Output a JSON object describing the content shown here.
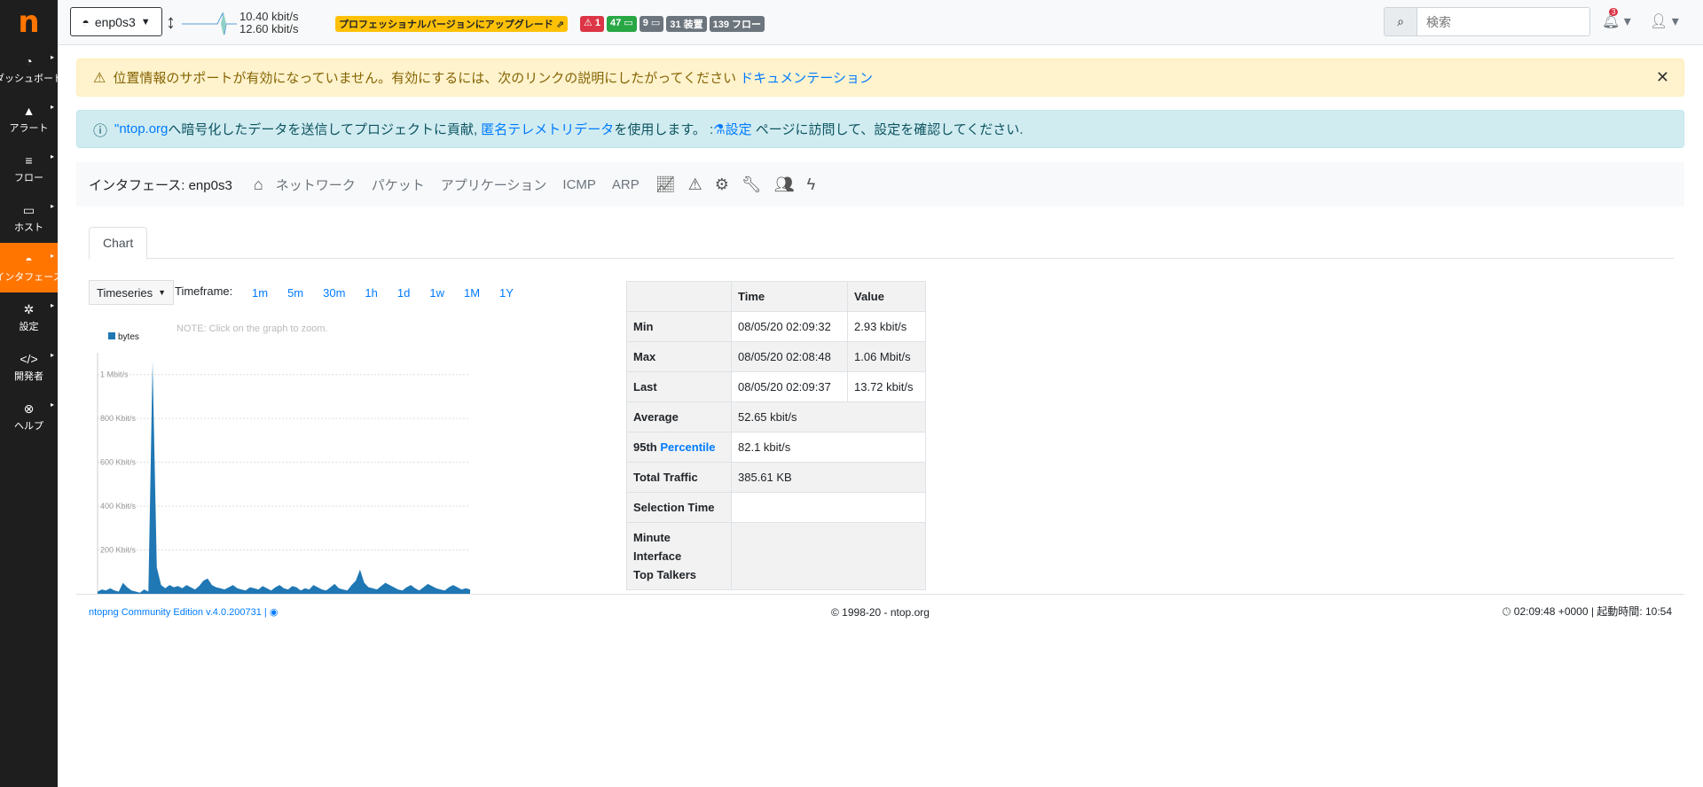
{
  "sidebar": {
    "logo": "n",
    "items": [
      {
        "label": "ダッシュボード",
        "icon": "dashboard-icon",
        "glyph": "◔"
      },
      {
        "label": "アラート",
        "icon": "warning-icon",
        "glyph": "▲"
      },
      {
        "label": "フロー",
        "icon": "flows-icon",
        "glyph": "≡"
      },
      {
        "label": "ホスト",
        "icon": "laptop-icon",
        "glyph": "▭"
      },
      {
        "label": "インタフェース",
        "icon": "ethernet-icon",
        "glyph": "◓"
      },
      {
        "label": "設定",
        "icon": "gear-icon",
        "glyph": "✲"
      },
      {
        "label": "開発者",
        "icon": "code-icon",
        "glyph": "</>"
      },
      {
        "label": "ヘルプ",
        "icon": "lifering-icon",
        "glyph": "⊗"
      }
    ]
  },
  "topbar": {
    "interface": "enp0s3",
    "rate_up": "10.40 kbit/s",
    "rate_down": "12.60 kbit/s",
    "upgrade": "プロフェッショナルバージョンにアップグレード",
    "badges": {
      "alerts": "1",
      "hosts": "47",
      "local": "9",
      "devices": "31 装置",
      "flows": "139 フロー"
    },
    "search_placeholder": "検索",
    "notifications": "3"
  },
  "alerts": {
    "warning_text": "位置情報のサポートが有効になっていません。有効にするには、次のリンクの説明にしたがってください",
    "warning_link": "ドキュメンテーション",
    "info_link1": "\"ntop.org",
    "info_text1": "へ暗号化したデータを送信してプロジェクトに貢献,",
    "info_link2": "匿名テレメトリデータ",
    "info_text2": "を使用します。 :",
    "info_link3": "設定",
    "info_text3": "ページに訪問して、設定を確認してください."
  },
  "ifnav": {
    "title": "インタフェース: enp0s3",
    "items": [
      "ネットワーク",
      "パケット",
      "アプリケーション",
      "ICMP",
      "ARP"
    ]
  },
  "tab": "Chart",
  "controls": {
    "timeseries": "Timeseries",
    "timeframe_label": "Timeframe:",
    "timeframes": [
      "1m",
      "5m",
      "30m",
      "1h",
      "1d",
      "1w",
      "1M",
      "1Y"
    ]
  },
  "chart_data": {
    "type": "area",
    "title": "",
    "note": "NOTE: Click on the graph to zoom.",
    "series": [
      {
        "name": "bytes",
        "color": "#1f77b4",
        "values": [
          10,
          20,
          15,
          25,
          15,
          10,
          50,
          30,
          15,
          10,
          5,
          20,
          10,
          1060,
          120,
          40,
          25,
          40,
          30,
          35,
          25,
          40,
          30,
          20,
          35,
          60,
          70,
          40,
          30,
          25,
          20,
          30,
          40,
          25,
          20,
          15,
          30,
          25,
          20,
          35,
          25,
          15,
          30,
          40,
          25,
          20,
          35,
          30,
          15,
          25,
          20,
          40,
          30,
          20,
          15,
          30,
          45,
          25,
          20,
          15,
          40,
          60,
          110,
          50,
          30,
          25,
          20,
          35,
          50,
          40,
          30,
          20,
          15,
          30,
          40,
          25,
          15,
          30,
          45,
          35,
          25,
          20,
          15,
          30,
          40,
          30,
          20,
          25,
          20
        ]
      }
    ],
    "y_ticks": [
      "200 Kbit/s",
      "400 Kbit/s",
      "600 Kbit/s",
      "800 Kbit/s",
      "1 Mbit/s"
    ],
    "y_tick_values": [
      200,
      400,
      600,
      800,
      1000
    ],
    "ylim": [
      0,
      1100
    ],
    "grid": true,
    "legend": "top-left"
  },
  "stats": {
    "col_time": "Time",
    "col_value": "Value",
    "min_label": "Min",
    "min_time": "08/05/20 02:09:32",
    "min_value": "2.93 kbit/s",
    "max_label": "Max",
    "max_time": "08/05/20 02:08:48",
    "max_value": "1.06 Mbit/s",
    "last_label": "Last",
    "last_time": "08/05/20 02:09:37",
    "last_value": "13.72 kbit/s",
    "avg_label": "Average",
    "avg_value": "52.65 kbit/s",
    "pct_label_a": "95th",
    "pct_label_b": "Percentile",
    "pct_value": "82.1 kbit/s",
    "total_label": "Total Traffic",
    "total_value": "385.61 KB",
    "sel_label": "Selection Time",
    "talkers_l1": "Minute",
    "talkers_l2": "Interface",
    "talkers_l3": "Top Talkers"
  },
  "footer": {
    "left": "ntopng Community Edition v.4.0.200731 |",
    "center": "© 1998-20 - ntop.org",
    "right": "02:09:48 +0000 | 起動時間: 10:54"
  }
}
